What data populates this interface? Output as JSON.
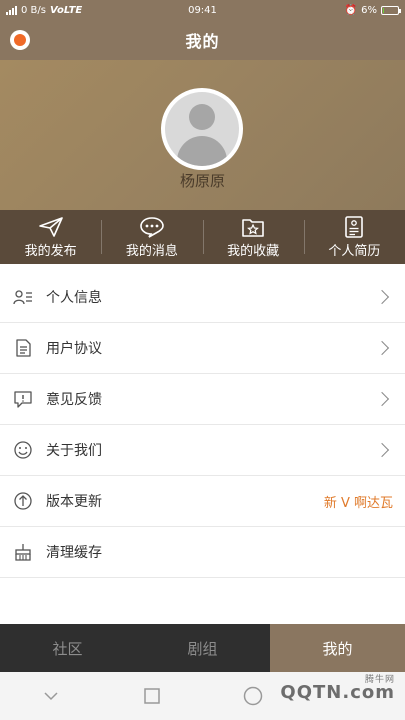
{
  "status_bar": {
    "signal_text": "0 B/s",
    "network": "VoLTE",
    "time": "09:41",
    "battery": "6%",
    "battery_level": 0.06
  },
  "header": {
    "title": "我的",
    "logo_icon": "app-logo-icon"
  },
  "profile": {
    "username": "杨原原",
    "avatar_icon": "default-avatar-icon"
  },
  "quick_nav": [
    {
      "label": "我的发布",
      "icon": "paper-plane-icon"
    },
    {
      "label": "我的消息",
      "icon": "chat-bubble-icon"
    },
    {
      "label": "我的收藏",
      "icon": "star-folder-icon"
    },
    {
      "label": "个人简历",
      "icon": "resume-icon"
    }
  ],
  "menu": [
    {
      "label": "个人信息",
      "icon": "person-info-icon"
    },
    {
      "label": "用户协议",
      "icon": "document-icon"
    },
    {
      "label": "意见反馈",
      "icon": "feedback-icon"
    },
    {
      "label": "关于我们",
      "icon": "smile-icon"
    },
    {
      "label": "版本更新",
      "icon": "upgrade-icon",
      "value": "新 V 啊达瓦"
    },
    {
      "label": "清理缓存",
      "icon": "broom-icon"
    }
  ],
  "tabs": [
    {
      "label": "社区",
      "active": false
    },
    {
      "label": "剧组",
      "active": false
    },
    {
      "label": "我的",
      "active": true
    }
  ],
  "watermark": {
    "text": "QQTN.com",
    "small": "腾牛网"
  },
  "colors": {
    "brand": "#8a7660",
    "accent": "#e07a2a",
    "tab_bg": "#2f2f2f"
  }
}
